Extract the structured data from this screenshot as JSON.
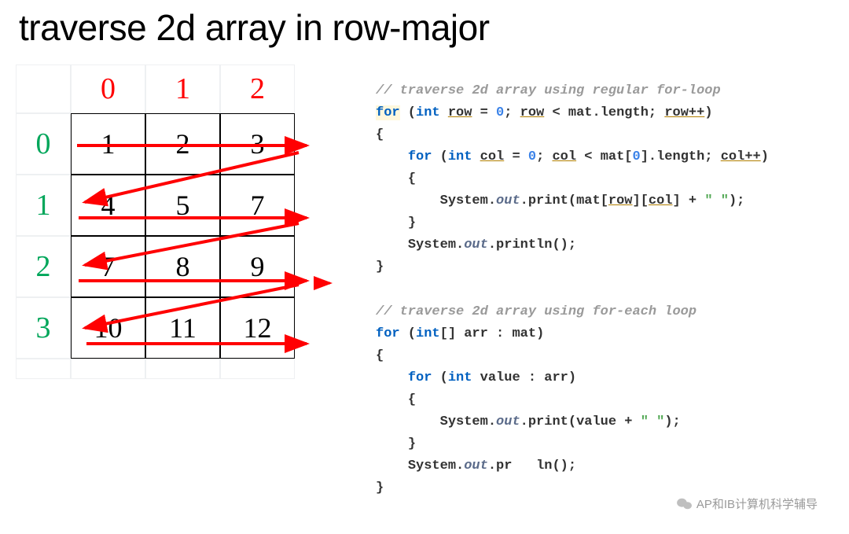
{
  "title": "traverse 2d array in row-major",
  "grid": {
    "col_headers": [
      "0",
      "1",
      "2"
    ],
    "row_headers": [
      "0",
      "1",
      "2",
      "3"
    ],
    "data": [
      [
        "1",
        "2",
        "3"
      ],
      [
        "4",
        "5",
        "7"
      ],
      [
        "7",
        "8",
        "9"
      ],
      [
        "10",
        "11",
        "12"
      ]
    ]
  },
  "code": {
    "c1": "// traverse 2d array using regular for-loop",
    "c2a": "for",
    "c2b": "int",
    "c2c": "row",
    "c2d": "0",
    "c2e": "row",
    "c2f": "mat",
    "c2g": "row++",
    "c3": "{",
    "c4a": "for",
    "c4b": "int",
    "c4c": "col",
    "c4d": "0",
    "c4e": "col",
    "c4f": "mat",
    "c4g": "0",
    "c4h": "col++",
    "c5": "{",
    "c6a": "System",
    "c6b": "out",
    "c6c": "print",
    "c6d": "mat",
    "c6e": "row",
    "c6f": "col",
    "c6g": "\" \"",
    "c7": "}",
    "c8a": "System",
    "c8b": "out",
    "c8c": "println",
    "c9": "}",
    "c11": "// traverse 2d array using for-each loop",
    "c12a": "for",
    "c12b": "int",
    "c12c": "arr",
    "c12d": "mat",
    "c13": "{",
    "c14a": "for",
    "c14b": "int",
    "c14c": "value",
    "c14d": "arr",
    "c15": "{",
    "c16a": "System",
    "c16b": "out",
    "c16c": "print",
    "c16d": "value",
    "c16e": "\" \"",
    "c17": "}",
    "c18a": "System",
    "c18b": "out",
    "c18c": "pr",
    "c18d": "ln",
    "c19": "}",
    "length_word": "length"
  },
  "watermark": "AP和IB计算机科学辅导"
}
